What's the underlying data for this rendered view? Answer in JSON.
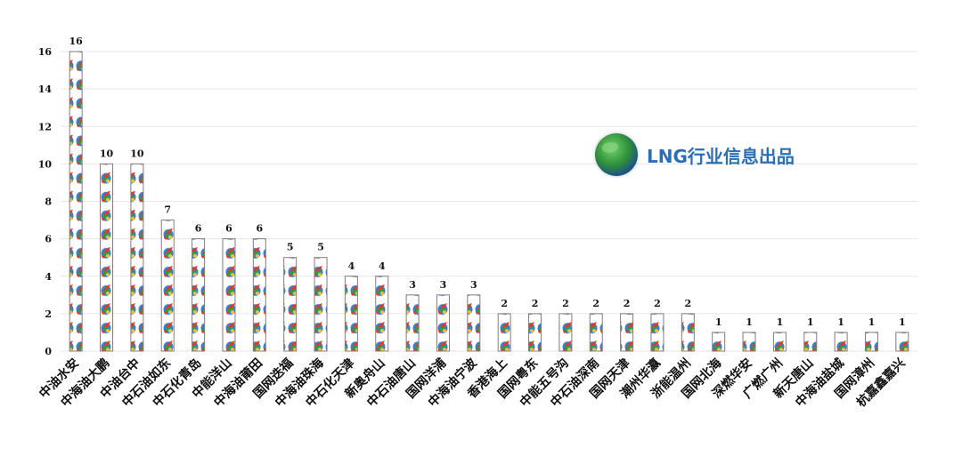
{
  "watermark": {
    "text": "LNG行业信息出品",
    "icon": "globe-icon"
  },
  "colors": {
    "bar_border": "#8a7a7a",
    "grid": "#e6e6e6",
    "axis_text": "#111111",
    "icon_red": "#e0392b",
    "icon_green": "#2f9e3a",
    "icon_yellow": "#f2c230",
    "icon_blue": "#3a7fd0"
  },
  "chart_data": {
    "type": "bar",
    "title": "",
    "xlabel": "",
    "ylabel": "",
    "ylim": [
      0,
      16
    ],
    "yticks": [
      0,
      2,
      4,
      6,
      8,
      10,
      12,
      14,
      16
    ],
    "grid": true,
    "categories": [
      "中油水安",
      "中海油大鹏",
      "中油台中",
      "中石油如东",
      "中石化青岛",
      "中能洋山",
      "中海油莆田",
      "国网迭福",
      "中海油珠海",
      "中石化天津",
      "新奥舟山",
      "中石油唐山",
      "国网洋浦",
      "中海油宁波",
      "香港海上",
      "国网粤东",
      "中能五号沟",
      "中石油深南",
      "国网天津",
      "潮州华瀛",
      "浙能温州",
      "国网北海",
      "深燃华安",
      "广燃广州",
      "新天唐山",
      "中海油盐城",
      "国网漳州",
      "杭嘉鑫嘉兴"
    ],
    "values": [
      16,
      10,
      10,
      7,
      6,
      6,
      6,
      5,
      5,
      4,
      4,
      3,
      3,
      3,
      2,
      2,
      2,
      2,
      2,
      2,
      2,
      1,
      1,
      1,
      1,
      1,
      1,
      1
    ],
    "data_labels": [
      "16",
      "10",
      "10",
      "7",
      "6",
      "6",
      "6",
      "5",
      "5",
      "4",
      "4",
      "3",
      "3",
      "3",
      "2",
      "2",
      "2",
      "2",
      "2",
      "2",
      "2",
      "1",
      "1",
      "1",
      "1",
      "1",
      "1",
      "1"
    ]
  }
}
